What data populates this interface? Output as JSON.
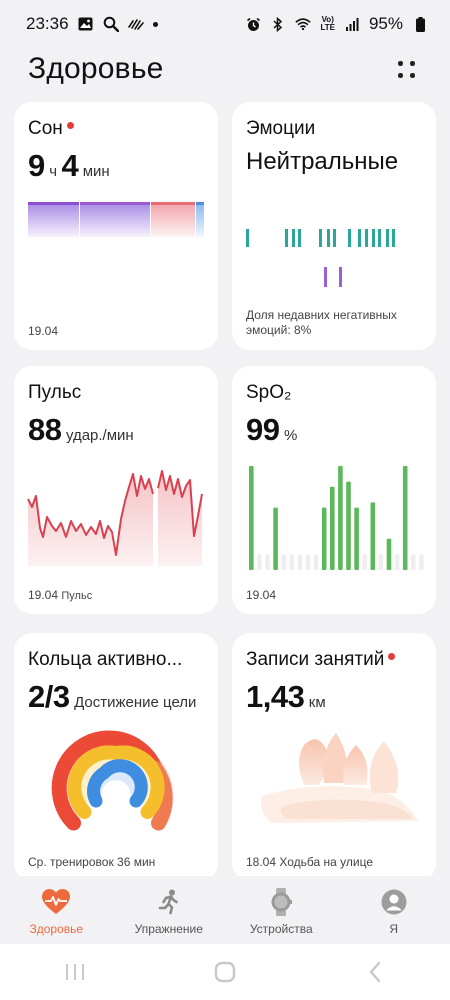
{
  "status_bar": {
    "time": "23:36",
    "battery": "95%",
    "lte_top": "Vo)",
    "lte_bottom": "LTE"
  },
  "header": {
    "title": "Здоровье"
  },
  "cards": {
    "sleep": {
      "title": "Сон",
      "hours": "9",
      "hours_unit": "ч",
      "minutes": "4",
      "minutes_unit": "мин",
      "date": "19.04"
    },
    "emotions": {
      "title": "Эмоции",
      "value": "Нейтральные",
      "note": "Доля недавних негативных эмоций: 8%"
    },
    "pulse": {
      "title": "Пульс",
      "value": "88",
      "unit": "удар./мин",
      "date": "19.04",
      "footer_label": "Пульс"
    },
    "spo2": {
      "title": "SpO₂",
      "value": "99",
      "unit": "%",
      "date": "19.04"
    },
    "rings": {
      "title": "Кольца активно...",
      "value": "2/3",
      "label": "Достижение цели",
      "footer": "Ср. тренировок 36 мин"
    },
    "workouts": {
      "title": "Записи занятий",
      "value": "1,43",
      "unit": "км",
      "date": "18.04",
      "footer_label": "Ходьба на улице"
    }
  },
  "bottom_nav": {
    "items": [
      {
        "label": "Здоровье",
        "icon": "heart-pulse-icon",
        "active": true
      },
      {
        "label": "Упражнение",
        "icon": "running-person-icon",
        "active": false
      },
      {
        "label": "Устройства",
        "icon": "watch-icon",
        "active": false
      },
      {
        "label": "Я",
        "icon": "profile-icon",
        "active": false
      }
    ]
  },
  "colors": {
    "accent": "#ee6a3e",
    "pulse": "#d9414f",
    "spo2": "#5cb85c",
    "emotion_teal": "#2aa69b",
    "emotion_purple": "#9a5fd6"
  }
}
